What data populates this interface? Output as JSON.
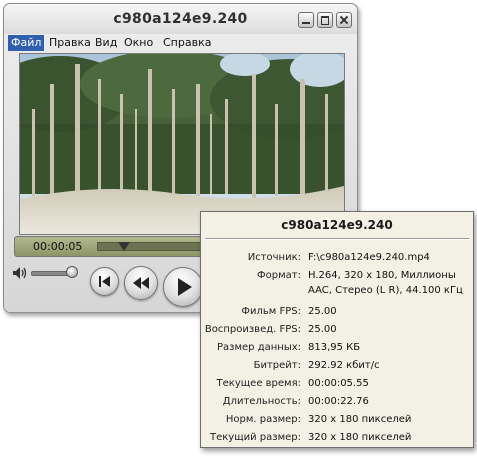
{
  "window": {
    "title": "c980a124e9.240"
  },
  "menu": [
    {
      "label": "Файл",
      "active": true
    },
    {
      "label": "Правка",
      "active": false
    },
    {
      "label": "Вид",
      "active": false
    },
    {
      "label": "Окно",
      "active": false
    },
    {
      "label": "Справка",
      "active": false
    }
  ],
  "player": {
    "timecode": "00:00:05",
    "playhead_fraction": 0.24
  },
  "info": {
    "title": "c980a124e9.240",
    "rows": [
      {
        "label": "Источник:",
        "value": "F:\\c980a124e9.240.mp4"
      },
      {
        "label": "Формат:",
        "value": "H.264, 320 x 180, Миллионы",
        "value2": "AAC, Стерео (L R), 44.100 кГц"
      },
      {
        "label": "Фильм FPS:",
        "value": "25.00"
      },
      {
        "label": "Воспроизвед. FPS:",
        "value": "25.00"
      },
      {
        "label": "Размер данных:",
        "value": "813,95 КБ"
      },
      {
        "label": "Битрейт:",
        "value": "292.92 кбит/с"
      },
      {
        "label": "Текущее время:",
        "value": "00:00:05.55"
      },
      {
        "label": "Длительность:",
        "value": "00:00:22.76"
      },
      {
        "label": "Норм. размер:",
        "value": "320 x 180 пикселей"
      },
      {
        "label": "Текущий размер:",
        "value": "320 x 180 пикселей"
      }
    ]
  },
  "colors": {
    "menu_highlight": "#2f5fad",
    "panel_bg": "#f2f1e3",
    "timebar": "#9ea47a"
  }
}
